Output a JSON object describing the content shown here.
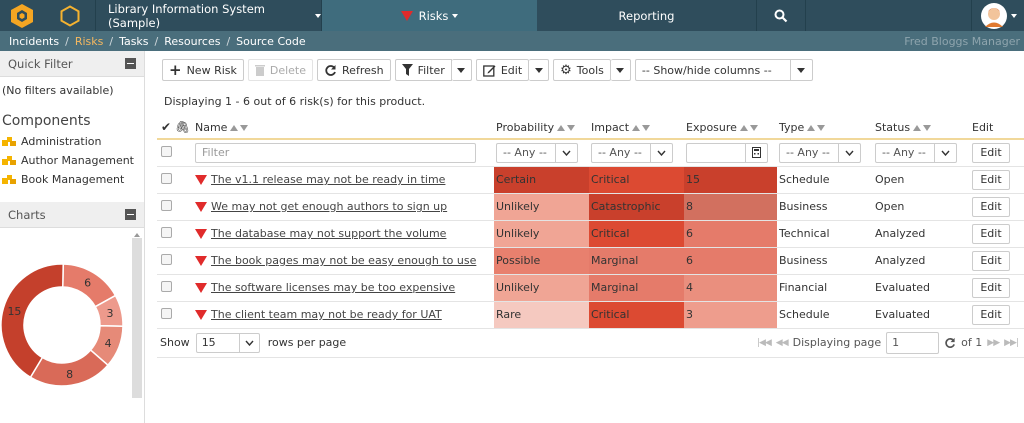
{
  "topbar": {
    "project": "Library Information System (Sample)",
    "current_module": "Risks",
    "reporting": "Reporting"
  },
  "breadcrumb": {
    "items": [
      "Incidents",
      "Risks",
      "Tasks",
      "Resources",
      "Source Code"
    ],
    "separator": "/",
    "user": "Fred Bloggs",
    "user_role": "Manager"
  },
  "sidebar": {
    "quick_filter_title": "Quick Filter",
    "no_filters": "(No filters available)",
    "components_title": "Components",
    "components": [
      "Administration",
      "Author Management",
      "Book Management"
    ],
    "charts_title": "Charts",
    "donut": {
      "segments": [
        {
          "label": "6",
          "value": 6,
          "color": "#e57b6a"
        },
        {
          "label": "3",
          "value": 3,
          "color": "#ed9a8c"
        },
        {
          "label": "4",
          "value": 4,
          "color": "#e68a78"
        },
        {
          "label": "8",
          "value": 8,
          "color": "#d96a58"
        },
        {
          "label": "15",
          "value": 15,
          "color": "#c4402c"
        }
      ]
    }
  },
  "toolbar": {
    "new_risk": "New Risk",
    "delete": "Delete",
    "refresh": "Refresh",
    "filter": "Filter",
    "edit": "Edit",
    "tools": "Tools",
    "show_hide": "-- Show/hide columns --"
  },
  "display_text": "Displaying 1 - 6 out of 6 risk(s) for this product.",
  "table": {
    "headers": {
      "name": "Name",
      "probability": "Probability",
      "impact": "Impact",
      "exposure": "Exposure",
      "type": "Type",
      "status": "Status",
      "edit": "Edit"
    },
    "filter": {
      "name_placeholder": "Filter",
      "any": "-- Any --",
      "edit": "Edit"
    },
    "rows": [
      {
        "name": "The v1.1 release may not be ready in time",
        "probability": "Certain",
        "impact": "Critical",
        "exposure": "15",
        "type": "Schedule",
        "status": "Open",
        "edit": "Edit",
        "pc": "#c9402c",
        "ic": "#dc4a32",
        "ec": "#c9402c"
      },
      {
        "name": "We may not get enough authors to sign up",
        "probability": "Unlikely",
        "impact": "Catastrophic",
        "exposure": "8",
        "type": "Business",
        "status": "Open",
        "edit": "Edit",
        "pc": "#f0a595",
        "ic": "#c9402c",
        "ec": "#d2705f"
      },
      {
        "name": "The database may not support the volume",
        "probability": "Unlikely",
        "impact": "Critical",
        "exposure": "6",
        "type": "Technical",
        "status": "Analyzed",
        "edit": "Edit",
        "pc": "#f0a595",
        "ic": "#dc4a32",
        "ec": "#e57b6a"
      },
      {
        "name": "The book pages may not be easy enough to use",
        "probability": "Possible",
        "impact": "Marginal",
        "exposure": "6",
        "type": "Business",
        "status": "Analyzed",
        "edit": "Edit",
        "pc": "#e8806e",
        "ic": "#e57b6a",
        "ec": "#e57b6a"
      },
      {
        "name": "The software licenses may be too expensive",
        "probability": "Unlikely",
        "impact": "Marginal",
        "exposure": "4",
        "type": "Financial",
        "status": "Evaluated",
        "edit": "Edit",
        "pc": "#f0a595",
        "ic": "#e57b6a",
        "ec": "#ea8f7e"
      },
      {
        "name": "The client team may not be ready for UAT",
        "probability": "Rare",
        "impact": "Critical",
        "exposure": "3",
        "type": "Schedule",
        "status": "Evaluated",
        "edit": "Edit",
        "pc": "#f5c9c0",
        "ic": "#dc4a32",
        "ec": "#ee9d8d"
      }
    ]
  },
  "pagination": {
    "show": "Show",
    "rows_value": "15",
    "rows_per_page": "rows per page",
    "displaying_page": "Displaying page",
    "page": "1",
    "of": "of 1"
  }
}
